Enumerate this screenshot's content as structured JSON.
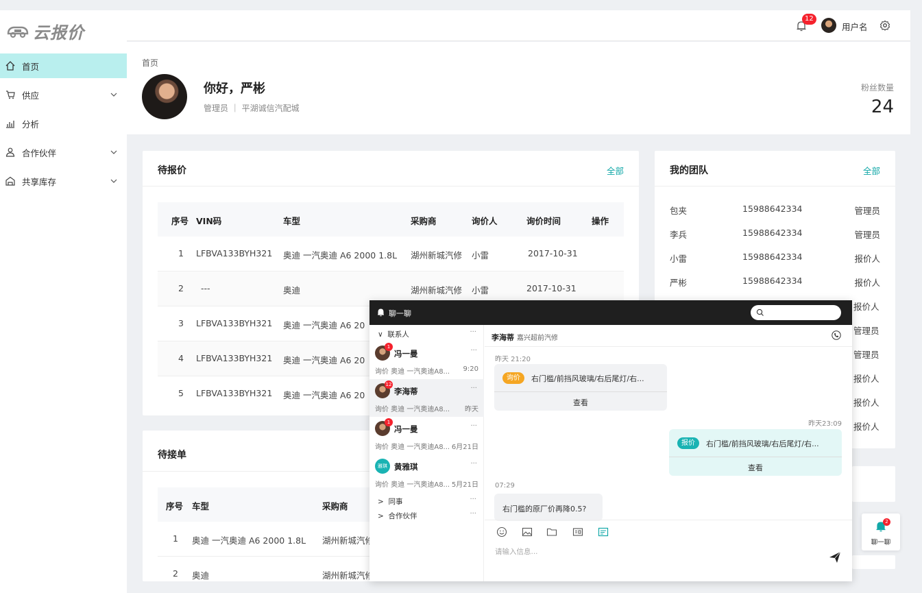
{
  "app": {
    "logo_text": "云报价"
  },
  "sidebar": {
    "items": [
      {
        "label": "首页",
        "icon": "home-icon",
        "active": true,
        "expandable": false
      },
      {
        "label": "供应",
        "icon": "cart-icon",
        "active": false,
        "expandable": true
      },
      {
        "label": "分析",
        "icon": "chart-icon",
        "active": false,
        "expandable": false
      },
      {
        "label": "合作伙伴",
        "icon": "people-icon",
        "active": false,
        "expandable": true
      },
      {
        "label": "共享库存",
        "icon": "warehouse-icon",
        "active": false,
        "expandable": true
      }
    ]
  },
  "topbar": {
    "notification_count": "12",
    "username": "用户名"
  },
  "profile": {
    "breadcrumb": "首页",
    "greeting": "你好，严彬",
    "role": "管理员 ｜ 平湖诚信汽配城",
    "fans_label": "粉丝数量",
    "fans_value": "24"
  },
  "pending_quotes": {
    "title": "待报价",
    "more": "全部",
    "headers": [
      "序号",
      "VIN码",
      "车型",
      "采购商",
      "询价人",
      "询价时间",
      "操作"
    ],
    "rows": [
      {
        "no": "1",
        "vin": "LFBVA133BYH321",
        "model": "奥迪 一汽奥迪 A6 2000 1.8L",
        "buyer": "湖州新城汽修",
        "inquirer": "小雷",
        "time": "2017-10-31"
      },
      {
        "no": "2",
        "vin": "---",
        "model": "奥迪",
        "buyer": "湖州新城汽修",
        "inquirer": "小雷",
        "time": "2017-10-31"
      },
      {
        "no": "3",
        "vin": "LFBVA133BYH321",
        "model": "奥迪 一汽奥迪 A6 20"
      },
      {
        "no": "4",
        "vin": "LFBVA133BYH321",
        "model": "奥迪 一汽奥迪 A6 20"
      },
      {
        "no": "5",
        "vin": "LFBVA133BYH321",
        "model": "奥迪 一汽奥迪 A6 20"
      }
    ]
  },
  "pending_orders": {
    "title": "待接单",
    "headers": [
      "序号",
      "车型",
      "采购商"
    ],
    "rows": [
      {
        "no": "1",
        "model": "奥迪 一汽奥迪 A6 2000 1.8L",
        "buyer": "湖州新城汽修"
      },
      {
        "no": "2",
        "model": "奥迪",
        "buyer": "湖州新城汽修"
      }
    ]
  },
  "team": {
    "title": "我的团队",
    "more": "全部",
    "members": [
      {
        "name": "包夹",
        "phone": "15988642334",
        "role": "管理员"
      },
      {
        "name": "李兵",
        "phone": "15988642334",
        "role": "管理员"
      },
      {
        "name": "小雷",
        "phone": "15988642334",
        "role": "报价人"
      },
      {
        "name": "严彬",
        "phone": "15988642334",
        "role": "报价人"
      }
    ],
    "hidden_roles": [
      "报价人",
      "管理员",
      "管理员",
      "报价人",
      "报价人",
      "报价人"
    ]
  },
  "chat": {
    "title": "聊一聊",
    "groups": {
      "contacts": "联系人",
      "colleagues": "同事",
      "partners": "合作伙伴"
    },
    "contacts": [
      {
        "name": "冯一曼",
        "badge": "1",
        "msg": "询价 奥迪 一汽奥迪A8...",
        "time": "9:20",
        "selected": false
      },
      {
        "name": "李海蒂",
        "badge": "12",
        "msg": "询价 奥迪 一汽奥迪A8...",
        "time": "昨天",
        "selected": true
      },
      {
        "name": "冯一曼",
        "badge": "1",
        "msg": "询价 奥迪 一汽奥迪A8...",
        "time": "6月21日",
        "selected": false
      },
      {
        "name": "黄雅琪",
        "badge": "",
        "avatar_text": "雅琪",
        "msg": "询价 奥迪 一汽奥迪A8...",
        "time": "5月21日",
        "selected": false
      }
    ],
    "conversation": {
      "name": "李海蒂",
      "company": "嘉兴超前汽修",
      "messages": [
        {
          "time": "昨天 21:20",
          "tag": "询价",
          "text": "右门槛/前挡风玻璃/右后尾灯/右...",
          "action": "查看"
        },
        {
          "time": "昨天23:09",
          "tag": "报价",
          "text": "右门槛/前挡风玻璃/右后尾灯/右...",
          "action": "查看"
        },
        {
          "time": "07:29",
          "text": "右门槛的原厂价再降0.5?"
        }
      ],
      "input_placeholder": "请输入信息..."
    },
    "float_button": {
      "label": "聊一聊",
      "badge": "2"
    }
  },
  "colors": {
    "accent": "#13a8a8",
    "active_nav": "#b9efee",
    "badge": "#f5222d",
    "quote_tag": "#f5a623",
    "offer_tag": "#19b3b3"
  }
}
